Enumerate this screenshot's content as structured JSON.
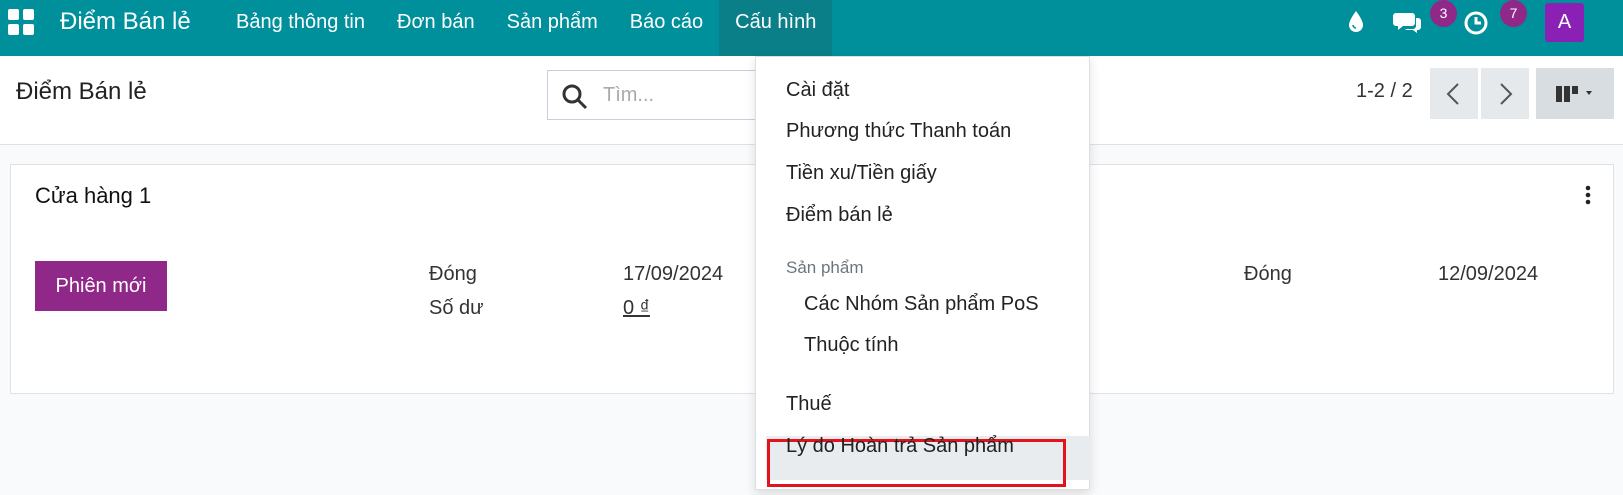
{
  "navbar": {
    "brand": "Điểm Bán lẻ",
    "menu": [
      {
        "label": "Bảng thông tin"
      },
      {
        "label": "Đơn bán"
      },
      {
        "label": "Sản phẩm"
      },
      {
        "label": "Báo cáo"
      },
      {
        "label": "Cấu hình"
      }
    ],
    "chat_count": "3",
    "activity_count": "7",
    "avatar_letter": "A"
  },
  "control": {
    "title": "Điểm Bán lẻ",
    "search_placeholder": "Tìm...",
    "pager": "1-2 / 2"
  },
  "card": {
    "title": "Cửa hàng 1",
    "new_session_label": "Phiên mới",
    "status_label": "Đóng",
    "status_date": "17/09/2024",
    "balance_label": "Số dư",
    "balance_value": "0 ₫",
    "status_label_2": "Đóng",
    "status_date_2": "12/09/2024"
  },
  "dropdown": {
    "items": [
      {
        "label": "Cài đặt"
      },
      {
        "label": "Phương thức Thanh toán"
      },
      {
        "label": "Tiền xu/Tiền giấy"
      },
      {
        "label": "Điểm bán lẻ"
      }
    ],
    "section_header": "Sản phẩm",
    "sub_items": [
      {
        "label": "Các Nhóm Sản phẩm PoS"
      },
      {
        "label": "Thuộc tính"
      }
    ],
    "tax_label": "Thuế",
    "return_reason_label": "Lý do Hoàn trả Sản phẩm"
  },
  "colors": {
    "navbar": "#00909b",
    "primary": "#8f2889",
    "avatar": "#8a21b4",
    "highlight_border": "#e3121b"
  }
}
